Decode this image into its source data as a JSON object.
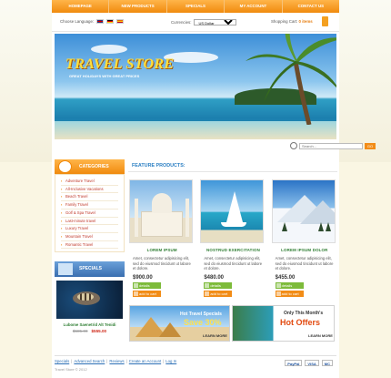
{
  "nav": [
    "HOMEPAGE",
    "NEW PRODUCTS",
    "SPECIALS",
    "MY ACCOUNT",
    "CONTACT US"
  ],
  "topbar": {
    "language_label": "Choose Language:",
    "currencies_label": "Currencies:",
    "currency_value": "US Dollar",
    "cart_label": "Shopping Cart:",
    "cart_value": "0 items"
  },
  "hero": {
    "title": "TRAVEL STORE",
    "subtitle": "GREAT HOLIDAYS WITH GREAT PRICES"
  },
  "search": {
    "placeholder": "Search...",
    "button": "GO"
  },
  "sidebar": {
    "categories_title": "CATEGORIES",
    "categories": [
      "Adventure Travel",
      "All-Inclusive Vacations",
      "Beach Travel",
      "Family Travel",
      "Golf & Spa Travel",
      "Last-minute travel",
      "Luxury Travel",
      "Mountain Travel",
      "Romantic Travel"
    ],
    "specials_title": "SPECIALS",
    "special_name": "Lubome Saenetrid Alt Tenidi",
    "special_old_price": "$585.00",
    "special_new_price": "$555.00"
  },
  "main": {
    "featured_title": "FEATURE PRODUCTS:",
    "products": [
      {
        "name": "LOREM IPSUM",
        "desc": "Amet, consectetur adipisicing elit, sed do eiusmod tincidunt ut labore et dolore.",
        "price": "$900.00",
        "detail": "details",
        "cart": "add to cart"
      },
      {
        "name": "NOSTRUD EXERCITATION",
        "desc": "Amet, consectetur adipisicing elit, sed do eiusmod tincidunt ut labore et dolore.",
        "price": "$480.00",
        "detail": "details",
        "cart": "add to cart"
      },
      {
        "name": "LOREM IPSUM DOLOR",
        "desc": "Amet, consectetur adipisicing elit, sed do eiusmod tincidunt ut labore et dolore.",
        "price": "$455.00",
        "detail": "details",
        "cart": "add to cart"
      }
    ],
    "banner1": {
      "line1": "Hot Travel Specials",
      "line2": "Save 30%",
      "link": "LEARN MORE"
    },
    "banner2": {
      "line1": "Only This Month's",
      "line2": "Hot Offers",
      "link": "LEARN MORE"
    }
  },
  "footer": {
    "links": [
      "Specials",
      "Advanced Search",
      "Reviews",
      "Create an Account",
      "Log In"
    ],
    "copyright": "Travel Store © 2012",
    "payments": [
      "PayPal",
      "VISA",
      "MC"
    ]
  },
  "colors": {
    "accent": "#f08a0e",
    "link": "#2b6fb5",
    "title_blue": "#2b7fc3"
  }
}
